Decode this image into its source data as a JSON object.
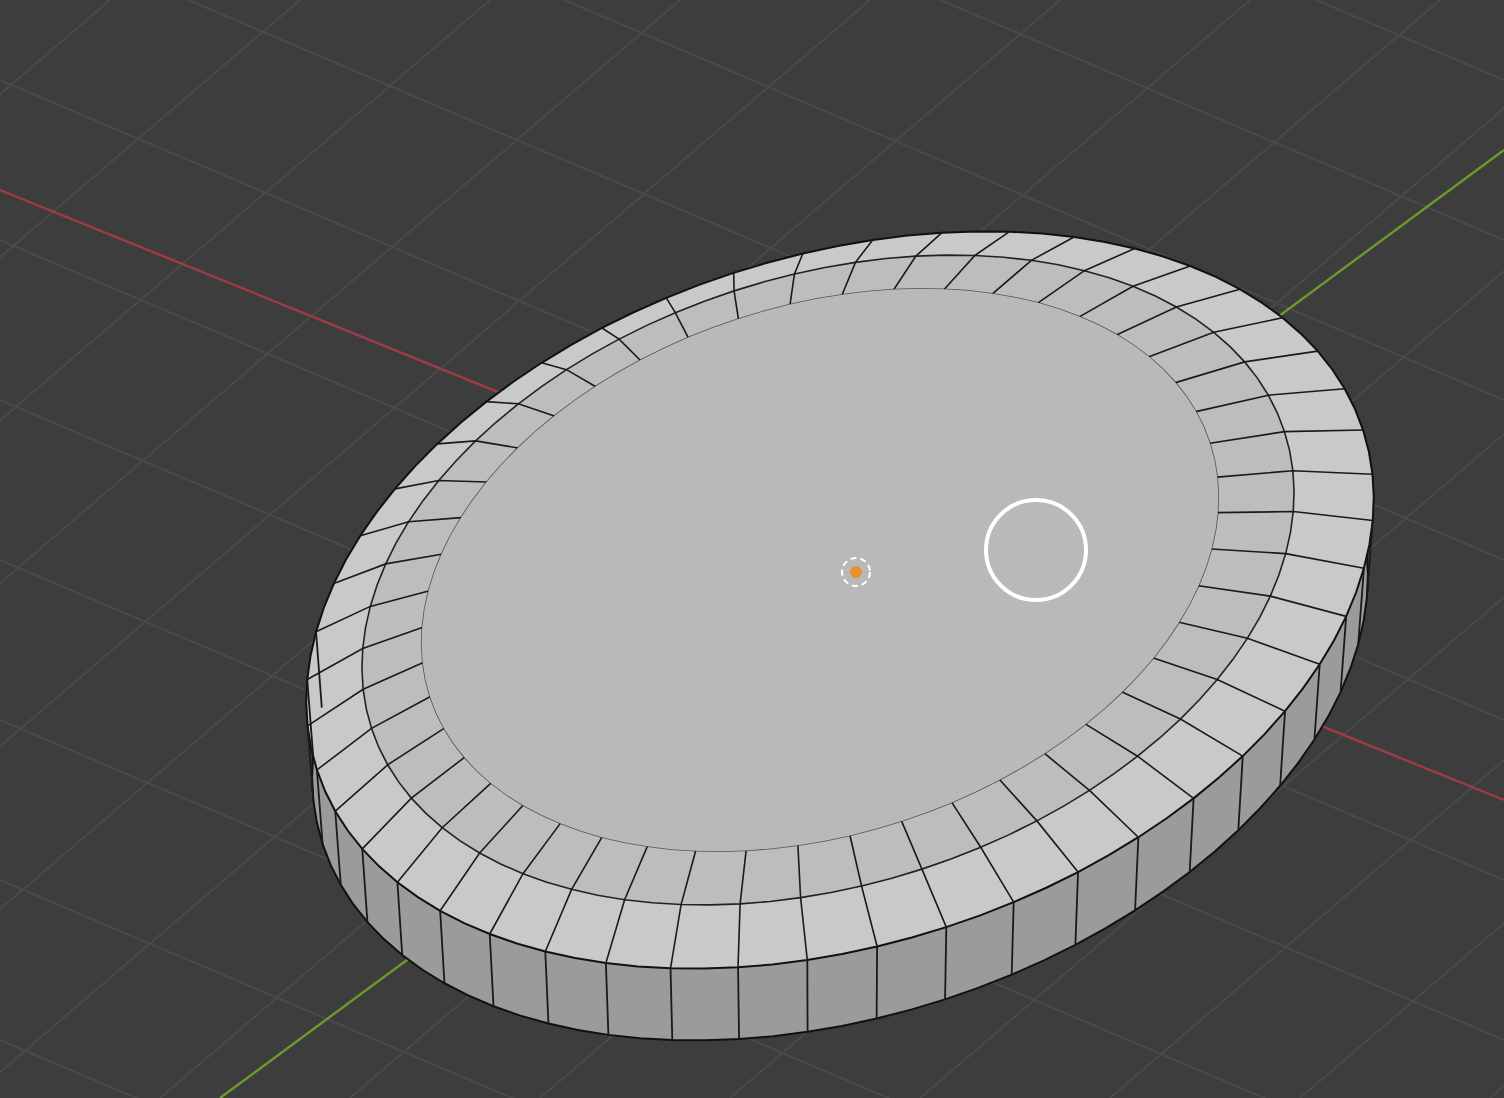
{
  "viewport": {
    "show_grid": true,
    "show_axes": true,
    "show_origin": true,
    "brush_cursor": true
  }
}
